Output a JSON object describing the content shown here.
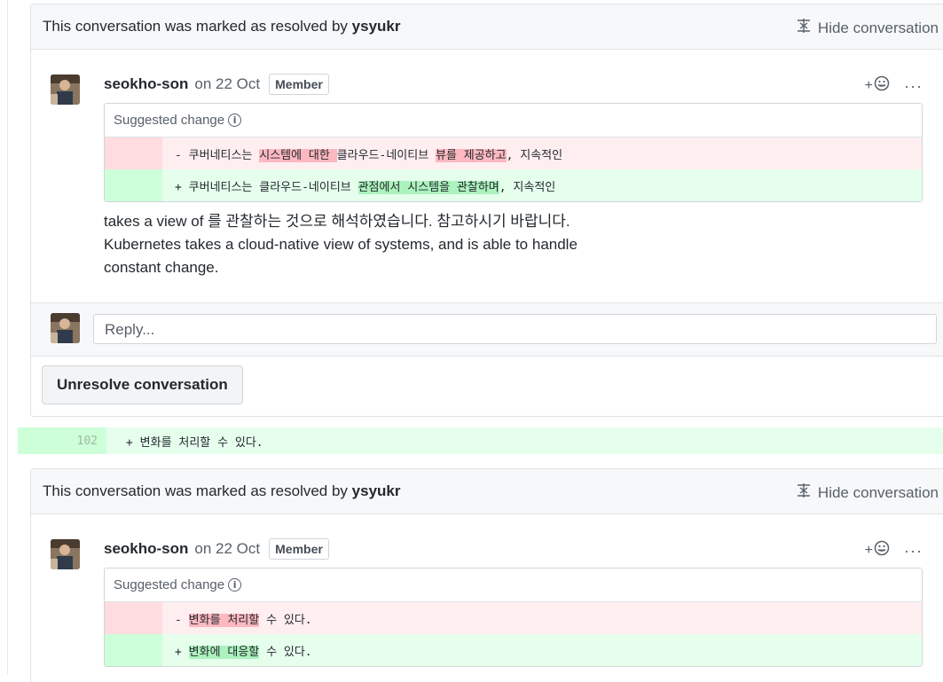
{
  "threads": [
    {
      "header_prefix": "This conversation was marked as resolved by",
      "resolver": "ysyukr",
      "hide_label": "Hide conversation",
      "comment": {
        "author": "seokho-son",
        "date": "on 22 Oct",
        "badge": "Member",
        "react_plus": "+",
        "more": "···",
        "suggestion_title": "Suggested change",
        "del": [
          "- 쿠버네티스는 ",
          "시스템에 대한 ",
          "클라우드-네이티브 ",
          "뷰를 제공하고",
          ", 지속적인"
        ],
        "add": [
          "+ 쿠버네티스는 클라우드-네이티브 ",
          "관점에서 시스템을 관찰하며",
          ", 지속적인"
        ],
        "body": [
          "takes a view of 를 관찰하는 것으로 해석하였습니다. 참고하시기 바랍니다.",
          "Kubernetes takes a cloud-native view of systems, and is able to handle",
          "constant change."
        ]
      },
      "reply_placeholder": "Reply...",
      "unresolve_label": "Unresolve conversation"
    },
    {
      "header_prefix": "This conversation was marked as resolved by",
      "resolver": "ysyukr",
      "hide_label": "Hide conversation",
      "comment": {
        "author": "seokho-son",
        "date": "on 22 Oct",
        "badge": "Member",
        "react_plus": "+",
        "more": "···",
        "suggestion_title": "Suggested change",
        "del": [
          "- ",
          "변화를 처리할",
          " 수 있다."
        ],
        "add": [
          "+ ",
          "변화에 대응할",
          " 수 있다."
        ]
      }
    }
  ],
  "code_line": {
    "number": "102",
    "text": "+ 변화를 처리할 수 있다."
  },
  "colors": {
    "del_bg": "#ffeef0",
    "del_highlight": "#fdb8c0",
    "add_bg": "#e6ffed",
    "add_highlight": "#acf2bd"
  },
  "icons": {
    "hide": "unfold-icon",
    "info": "info-icon",
    "react": "smiley-icon",
    "more": "kebab-icon"
  }
}
